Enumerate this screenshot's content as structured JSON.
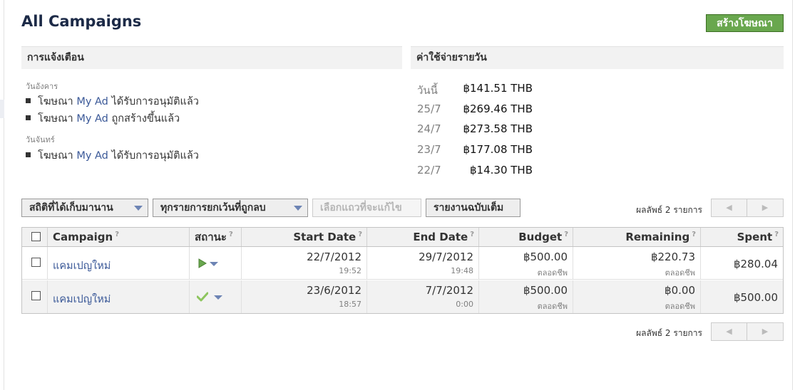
{
  "page": {
    "title": "All Campaigns",
    "create_ad_label": "สร้างโฆษณา"
  },
  "notifications": {
    "header": "การแจ้งเตือน",
    "groups": [
      {
        "day": "วันอังคาร",
        "items": [
          {
            "prefix": "โฆษณา",
            "link": "My Ad",
            "suffix": "ได้รับการอนุมัติแล้ว"
          },
          {
            "prefix": "โฆษณา",
            "link": "My Ad",
            "suffix": "ถูกสร้างขึ้นแล้ว"
          }
        ]
      },
      {
        "day": "วันจันทร์",
        "items": [
          {
            "prefix": "โฆษณา",
            "link": "My Ad",
            "suffix": "ได้รับการอนุมัติแล้ว"
          }
        ]
      }
    ]
  },
  "daily_spend": {
    "header": "ค่าใช้จ่ายรายวัน",
    "rows": [
      {
        "label": "วันนี้",
        "amount": "฿141.51 THB"
      },
      {
        "label": "25/7",
        "amount": "฿269.46 THB"
      },
      {
        "label": "24/7",
        "amount": "฿273.58 THB"
      },
      {
        "label": "23/7",
        "amount": "฿177.08 THB"
      },
      {
        "label": "22/7",
        "amount": "฿14.30 THB"
      }
    ]
  },
  "toolbar": {
    "lifetime_stats_label": "สถิติที่ได้เก็บมานาน",
    "filter_label": "ทุกรายการยกเว้นที่ถูกลบ",
    "edit_rows_label": "เลือกแถวที่จะแก้ไข",
    "full_report_label": "รายงานฉบับเต็ม"
  },
  "pagination": {
    "results_text": "ผลลัพธ์ 2 รายการ",
    "prev_symbol": "◀",
    "next_symbol": "▶"
  },
  "table": {
    "columns": {
      "campaign": "Campaign",
      "status": "สถานะ",
      "start_date": "Start Date",
      "end_date": "End Date",
      "budget": "Budget",
      "remaining": "Remaining",
      "spent": "Spent"
    },
    "help_symbol": "?",
    "rows": [
      {
        "campaign": "แคมเปญใหม่",
        "status_icon": "play-icon",
        "start_date": "22/7/2012",
        "start_time": "19:52",
        "end_date": "29/7/2012",
        "end_time": "19:48",
        "budget": "฿500.00",
        "budget_type": "ตลอดชีพ",
        "remaining": "฿220.73",
        "remaining_type": "ตลอดชีพ",
        "spent": "฿280.04"
      },
      {
        "campaign": "แคมเปญใหม่",
        "status_icon": "check-icon",
        "start_date": "23/6/2012",
        "start_time": "18:57",
        "end_date": "7/7/2012",
        "end_time": "0:00",
        "budget": "฿500.00",
        "budget_type": "ตลอดชีพ",
        "remaining": "฿0.00",
        "remaining_type": "ตลอดชีพ",
        "spent": "฿500.00"
      }
    ]
  },
  "colors": {
    "title": "#1c2a47",
    "link": "#3b5998",
    "create_button": "#69a74e",
    "play_icon": "#69a74e",
    "check_icon": "#8dc55e",
    "caret": "#6d84b4"
  }
}
